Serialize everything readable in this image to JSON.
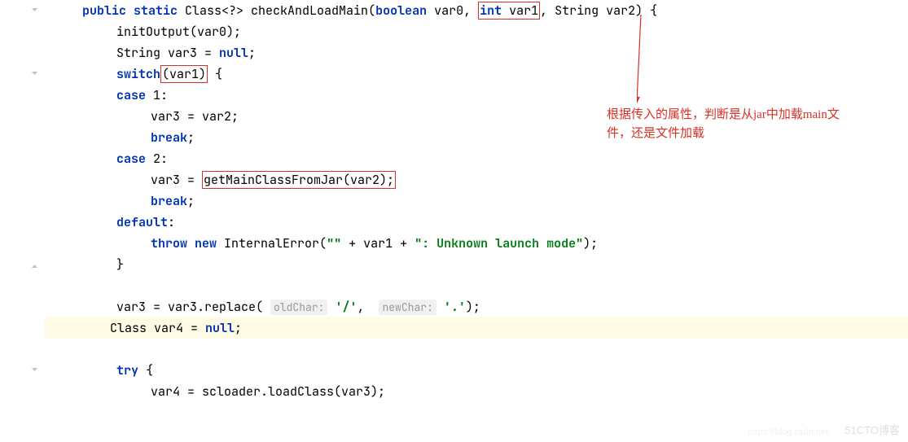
{
  "code": {
    "l1_public": "public",
    "l1_static": "static",
    "l1_class": " Class<?> checkAndLoadMain(",
    "l1_boolean": "boolean",
    "l1_var0": " var0, ",
    "l1_int": "int",
    "l1_var1": " var1",
    "l1_rest": ", String var2) {",
    "l2": "initOutput(var0);",
    "l3a": "String var3 = ",
    "l3_null": "null",
    "l3b": ";",
    "l4_switch": "switch",
    "l4_var1": "(var1)",
    "l4_brace": " {",
    "l5_case": "case",
    "l5_num": " 1:",
    "l6": "var3 = var2;",
    "l7_break": "break",
    "l7_semi": ";",
    "l8_case": "case",
    "l8_num": " 2:",
    "l9a": "var3 = ",
    "l9_boxed": "getMainClassFromJar(var2);",
    "l10_break": "break",
    "l10_semi": ";",
    "l11_default": "default",
    "l11_colon": ":",
    "l12_throw": "throw",
    "l12_new": "new",
    "l12_a": " InternalError(",
    "l12_str1": "\"\"",
    "l12_b": " + var1 + ",
    "l12_str2": "\": Unknown launch mode\"",
    "l12_c": ");",
    "l13": "}",
    "l15a": "var3 = var3.replace(",
    "l15_hint1": "oldChar:",
    "l15_str1": " '/'",
    "l15b": ", ",
    "l15_hint2": "newChar:",
    "l15_str2": " '.'",
    "l15c": ");",
    "l16a": "Class var4 = ",
    "l16_null": "null",
    "l16b": ";",
    "l18_try": "try",
    "l18_brace": " {",
    "l19": "var4 = scloader.loadClass(var3);"
  },
  "annotation": {
    "line1": "根据传入的属性，判断是从jar中加载main文",
    "line2": "件，还是文件加载"
  },
  "watermark": "51CTO博客",
  "watermark2": "https://blog.csdn.net/"
}
